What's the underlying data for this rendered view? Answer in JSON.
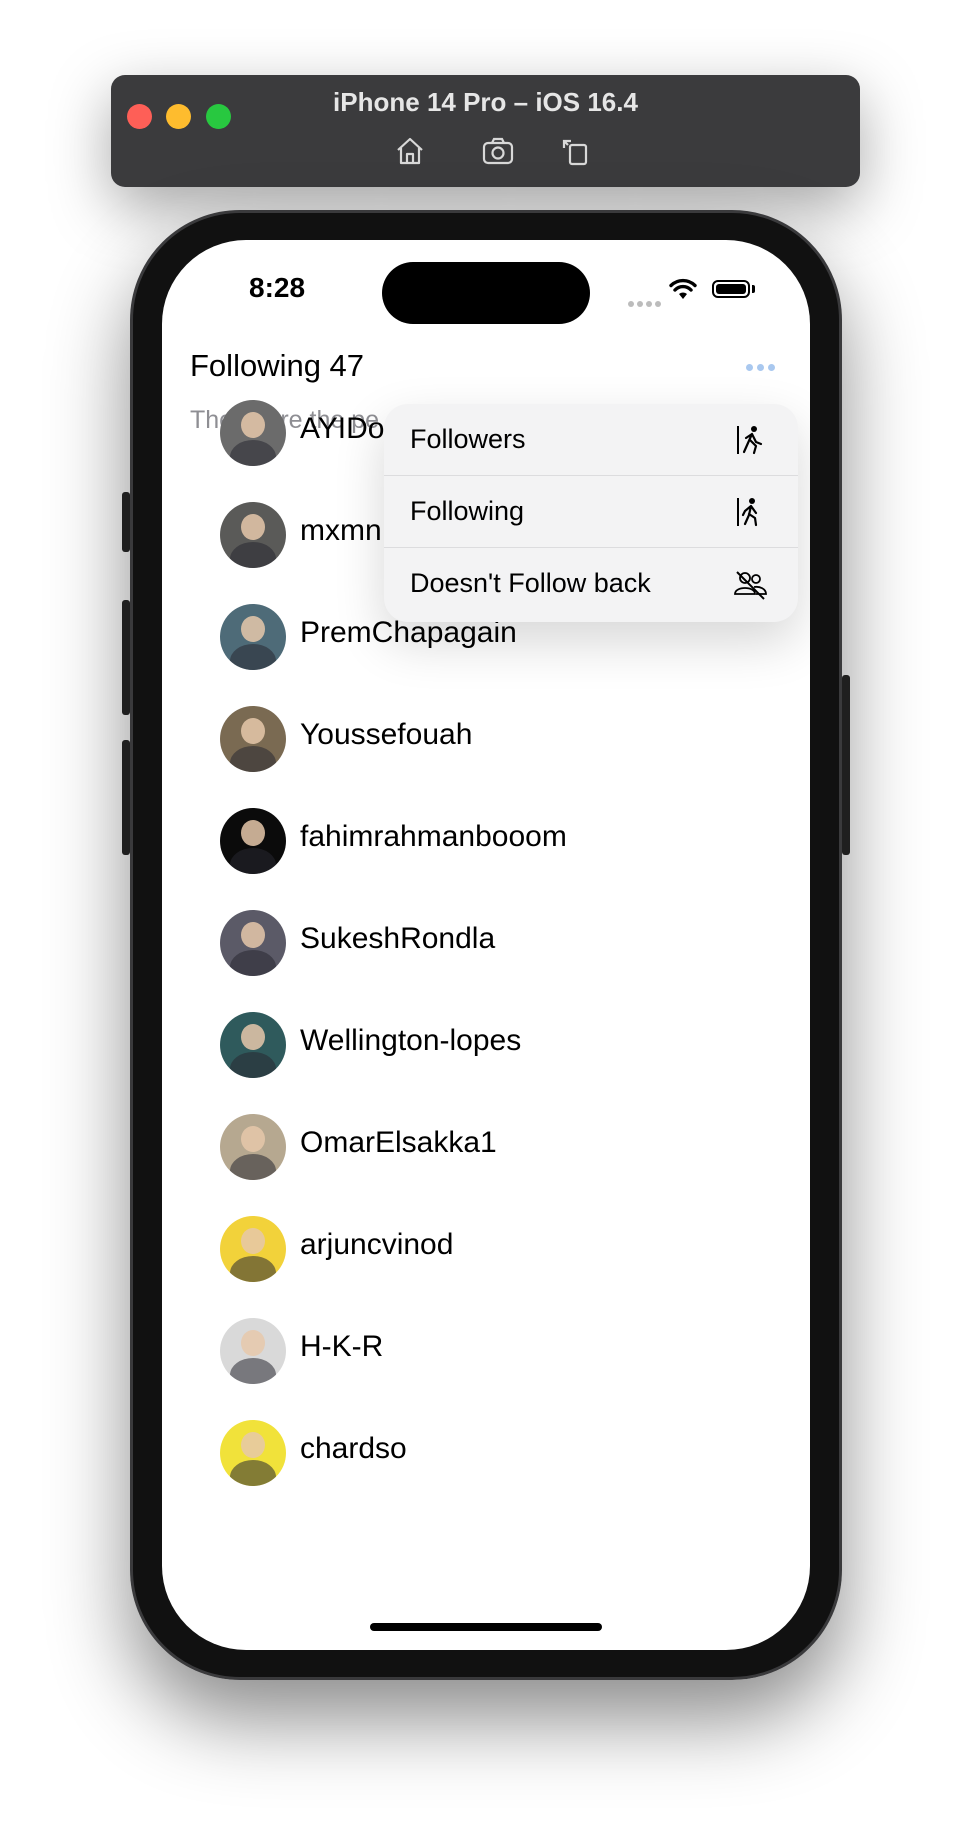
{
  "simulator": {
    "title": "iPhone 14 Pro – iOS 16.4",
    "tools": [
      "home-icon",
      "screenshot-icon",
      "rotate-icon"
    ]
  },
  "status_bar": {
    "time": "8:28"
  },
  "header": {
    "title": "Following 47",
    "subtitle": "These are the pe"
  },
  "users": [
    {
      "name": "AYIDo",
      "avatar_color": "#6b6b6b"
    },
    {
      "name": "mxmn",
      "avatar_color": "#5a5a58"
    },
    {
      "name": "PremChapagain",
      "avatar_color": "#4e6b78"
    },
    {
      "name": "Youssefouah",
      "avatar_color": "#7a6a52"
    },
    {
      "name": "fahimrahmanbooom",
      "avatar_color": "#0b0b0b"
    },
    {
      "name": "SukeshRondla",
      "avatar_color": "#5b5a67"
    },
    {
      "name": "Wellington-lopes",
      "avatar_color": "#2f5a5c"
    },
    {
      "name": "OmarElsakka1",
      "avatar_color": "#b6a890"
    },
    {
      "name": "arjuncvinod",
      "avatar_color": "#f2d23a"
    },
    {
      "name": "H-K-R",
      "avatar_color": "#d9d9d9"
    },
    {
      "name": "chardso",
      "avatar_color": "#f1e23a"
    }
  ],
  "menu": {
    "items": [
      {
        "label": "Followers",
        "icon": "person-walking-out-icon"
      },
      {
        "label": "Following",
        "icon": "person-walking-in-icon"
      },
      {
        "label": "Doesn't Follow back",
        "icon": "person-slash-icon"
      }
    ]
  },
  "colors": {
    "accent": "#a9c8ef",
    "subtitle": "#8e8e93"
  }
}
